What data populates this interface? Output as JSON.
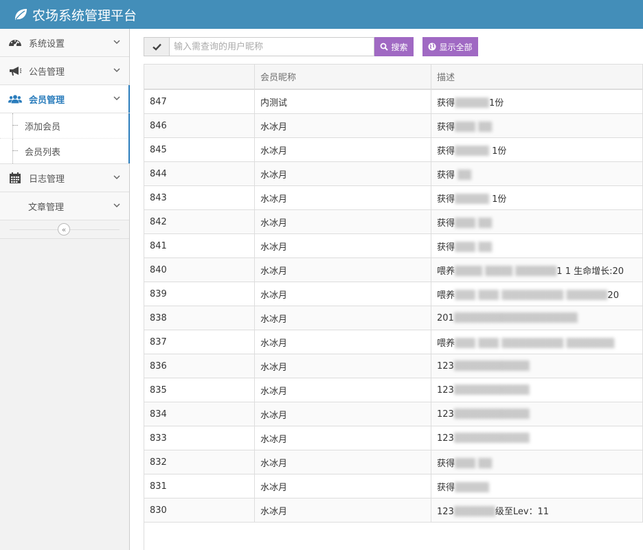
{
  "app": {
    "title": "农场系统管理平台"
  },
  "sidebar": {
    "items": [
      {
        "label": "系统设置",
        "icon": "dashboard-icon"
      },
      {
        "label": "公告管理",
        "icon": "megaphone-icon"
      },
      {
        "label": "会员管理",
        "icon": "users-icon",
        "active": true
      },
      {
        "label": "日志管理",
        "icon": "calendar-icon"
      },
      {
        "label": "文章管理",
        "icon": ""
      }
    ],
    "submenu": [
      {
        "label": "添加会员"
      },
      {
        "label": "会员列表"
      }
    ],
    "collapse_glyph": "«"
  },
  "search": {
    "placeholder": "输入需查询的用户昵称",
    "search_label": "搜索",
    "show_all_label": "显示全部"
  },
  "table": {
    "headers": [
      "",
      "会员昵称",
      "描述"
    ],
    "rows": [
      {
        "id": "847",
        "nickname": "内测试",
        "desc": "获得▒▒▒▒▒1份"
      },
      {
        "id": "846",
        "nickname": "水冰月",
        "desc": "获得▒▒▒ ▒▒"
      },
      {
        "id": "845",
        "nickname": "水冰月",
        "desc": "获得▒▒▒▒▒ 1份"
      },
      {
        "id": "844",
        "nickname": "水冰月",
        "desc": "获得 ▒▒"
      },
      {
        "id": "843",
        "nickname": "水冰月",
        "desc": "获得▒▒▒▒▒ 1份"
      },
      {
        "id": "842",
        "nickname": "水冰月",
        "desc": "获得▒▒▒ ▒▒"
      },
      {
        "id": "841",
        "nickname": "水冰月",
        "desc": "获得▒▒▒ ▒▒"
      },
      {
        "id": "840",
        "nickname": "水冰月",
        "desc": "喂养▒▒▒▒ ▒▒▒▒ ▒▒▒▒▒▒1 1 生命增长:20"
      },
      {
        "id": "839",
        "nickname": "水冰月",
        "desc": "喂养▒▒▒ ▒▒▒ ▒▒▒▒▒▒▒▒▒ ▒▒▒▒▒▒20"
      },
      {
        "id": "838",
        "nickname": "水冰月",
        "desc": "201▒▒▒▒▒▒▒▒▒▒▒▒▒▒▒▒▒▒"
      },
      {
        "id": "837",
        "nickname": "水冰月",
        "desc": "喂养▒▒▒ ▒▒▒ ▒▒▒▒▒▒▒▒▒ ▒▒▒▒▒▒▒"
      },
      {
        "id": "836",
        "nickname": "水冰月",
        "desc": "123▒▒▒▒▒▒▒▒▒▒▒"
      },
      {
        "id": "835",
        "nickname": "水冰月",
        "desc": "123▒▒▒▒▒▒▒▒▒▒▒"
      },
      {
        "id": "834",
        "nickname": "水冰月",
        "desc": "123▒▒▒▒▒▒▒▒▒▒▒"
      },
      {
        "id": "833",
        "nickname": "水冰月",
        "desc": "123▒▒▒▒▒▒▒▒▒▒▒"
      },
      {
        "id": "832",
        "nickname": "水冰月",
        "desc": "获得▒▒▒ ▒▒"
      },
      {
        "id": "831",
        "nickname": "水冰月",
        "desc": "获得▒▒▒▒▒"
      },
      {
        "id": "830",
        "nickname": "水冰月",
        "desc": "123▒▒▒▒▒▒级至Lev：11"
      }
    ]
  },
  "colors": {
    "header_bg": "#438eb9",
    "active_accent": "#2b7dbc",
    "button_purple": "#a069c3"
  }
}
